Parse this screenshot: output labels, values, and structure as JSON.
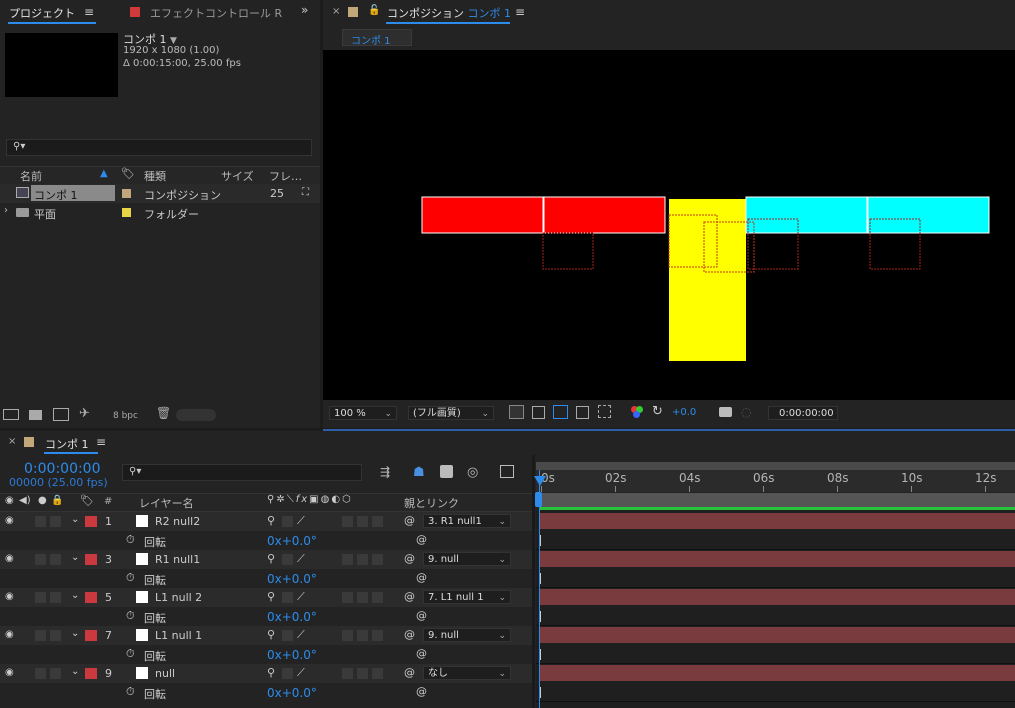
{
  "project_panel": {
    "tab_project": "プロジェクト",
    "tab_effects": "エフェクトコントロール R",
    "comp_name": "コンポ 1",
    "comp_size": "1920 x 1080 (1.00)",
    "comp_duration": "Δ 0:00:15:00, 25.00 fps",
    "search_placeholder": "",
    "columns": {
      "name": "名前",
      "type": "種類",
      "size": "サイズ",
      "frame": "フレ…"
    },
    "items": [
      {
        "name": "コンポ 1",
        "type": "コンポジション",
        "frame": "25",
        "color": "#c2a77a"
      },
      {
        "name": "平面",
        "type": "フォルダー",
        "frame": "",
        "color": "#e8d444"
      }
    ],
    "bpc": "8 bpc"
  },
  "composition_panel": {
    "title": "コンポジション",
    "title_comp": "コンポ 1",
    "subtab": "コンポ 1",
    "zoom": "100 %",
    "resolution": "(フル画質)",
    "exposure": "+0.0",
    "timecode": "0:00:00:00",
    "colors": {
      "red": "#ff0000",
      "cyan": "#00ffff",
      "yellow": "#ffff00"
    }
  },
  "timeline": {
    "tab_label": "コンポ 1",
    "current_time": "0:00:00:00",
    "frame_info": "00000 (25.00 fps)",
    "columns": {
      "num": "#",
      "layer_name": "レイヤー名",
      "parent": "親とリンク"
    },
    "ruler": [
      "0s",
      "02s",
      "04s",
      "06s",
      "08s",
      "10s",
      "12s"
    ],
    "layers": [
      {
        "num": "1",
        "name": "R2 null2",
        "parent": "3. R1 null1",
        "prop": "回転",
        "value": "0x+0.0°"
      },
      {
        "num": "3",
        "name": "R1 null1",
        "parent": "9. null",
        "prop": "回転",
        "value": "0x+0.0°"
      },
      {
        "num": "5",
        "name": "L1 null 2",
        "parent": "7. L1 null 1",
        "prop": "回転",
        "value": "0x+0.0°"
      },
      {
        "num": "7",
        "name": "L1 null 1",
        "parent": "9. null",
        "prop": "回転",
        "value": "0x+0.0°"
      },
      {
        "num": "9",
        "name": "null",
        "parent": "なし",
        "prop": "回転",
        "value": "0x+0.0°"
      }
    ]
  }
}
